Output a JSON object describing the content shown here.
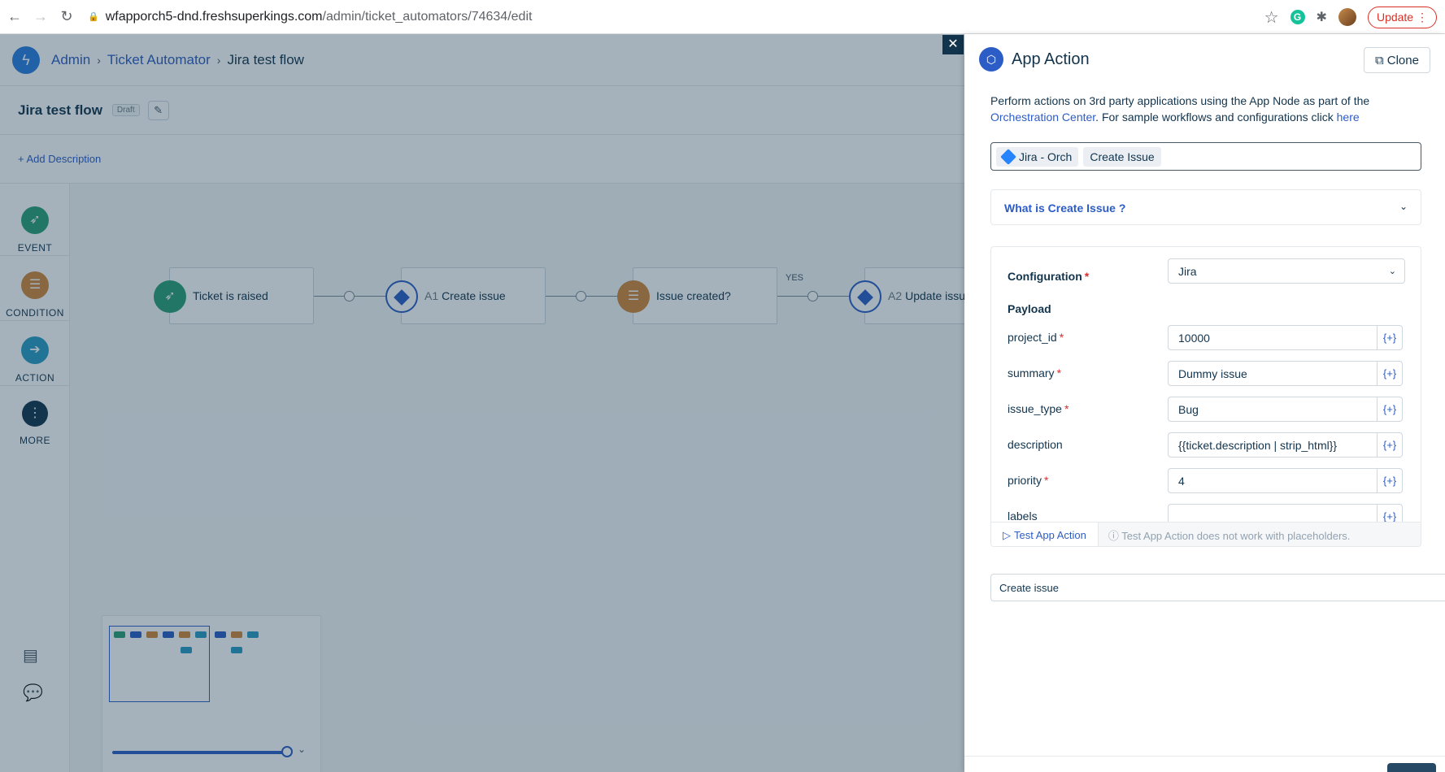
{
  "browser": {
    "url_host": "wfapporch5-dnd.freshsuperkings.com",
    "url_path": "/admin/ticket_automators/74634/edit",
    "update_label": "Update"
  },
  "breadcrumb": {
    "admin": "Admin",
    "ticket_automator": "Ticket Automator",
    "current": "Jira test flow"
  },
  "flow": {
    "title": "Jira test flow",
    "status": "Draft",
    "add_description": "+ Add Description"
  },
  "palette": {
    "event": "EVENT",
    "condition": "CONDITION",
    "action": "ACTION",
    "more": "MORE"
  },
  "canvas": {
    "node1": "Ticket is raised",
    "node2_prefix": "A1",
    "node2": "Create issue",
    "node3": "Issue created?",
    "branch_label": "YES",
    "node4_prefix": "A2",
    "node4": "Update issu"
  },
  "panel": {
    "title": "App Action",
    "clone_label": "Clone",
    "desc_part1": "Perform actions on 3rd party applications using the App Node as part of the ",
    "desc_link1": "Orchestration Center",
    "desc_part2": ". For sample workflows and configurations click ",
    "desc_link2": "here",
    "app_chip": "Jira - Orch",
    "action_chip": "Create Issue",
    "accordion_title": "What is Create Issue ?",
    "config_label": "Configuration",
    "config_value": "Jira",
    "payload_label": "Payload",
    "fields": [
      {
        "label": "project_id",
        "value": "10000",
        "required": "*"
      },
      {
        "label": "summary",
        "value": "Dummy issue",
        "required": "*"
      },
      {
        "label": "issue_type",
        "value": "Bug",
        "required": "*"
      },
      {
        "label": "description",
        "value": "{{ticket.description | strip_html}}",
        "required": ""
      },
      {
        "label": "priority",
        "value": "4",
        "required": "*"
      },
      {
        "label": "labels",
        "value": "",
        "required": ""
      }
    ],
    "placeholder_button": "{+}",
    "test_button": "Test App Action",
    "test_note": "Test App Action does not work with placeholders.",
    "node_name": "Create issue"
  },
  "colors": {
    "event": "#2c9f76",
    "condition": "#d1873a",
    "action": "#2a9bc4",
    "more": "#12344d",
    "accent": "#2c5cc5"
  }
}
